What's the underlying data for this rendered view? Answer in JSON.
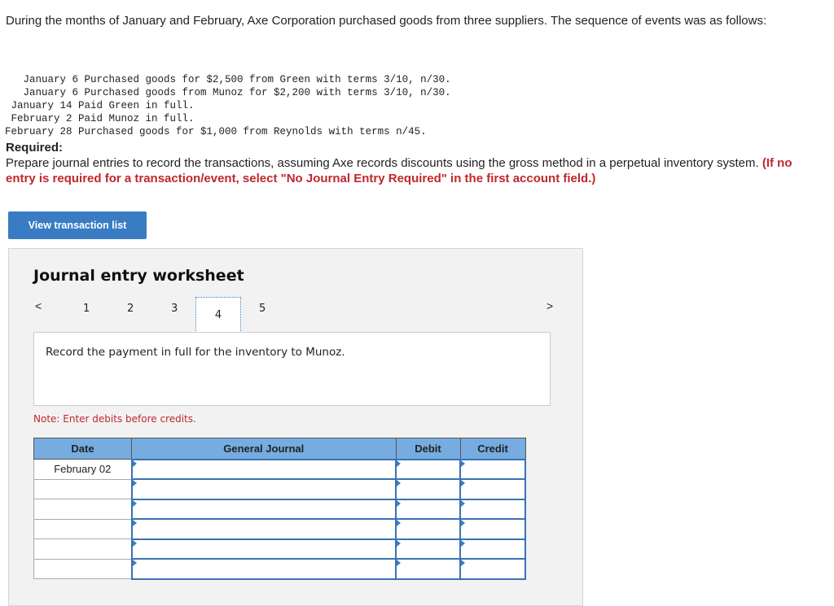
{
  "intro": "During the months of January and February, Axe Corporation purchased goods from three suppliers. The sequence of events was as follows:",
  "events": [
    "   January 6 Purchased goods for $2,500 from Green with terms 3/10, n/30.",
    "   January 6 Purchased goods from Munoz for $2,200 with terms 3/10, n/30.",
    " January 14 Paid Green in full.",
    " February 2 Paid Munoz in full.",
    "February 28 Purchased goods for $1,000 from Reynolds with terms n/45."
  ],
  "required": {
    "heading": "Required:",
    "text": "Prepare journal entries to record the transactions, assuming Axe records discounts using the gross method in a perpetual inventory system.",
    "note": "(If no entry is required for a transaction/event, select \"No Journal Entry Required\" in the first account field.)"
  },
  "view_button": "View transaction list",
  "worksheet": {
    "title": "Journal entry worksheet",
    "pages": [
      "1",
      "2",
      "3",
      "4",
      "5"
    ],
    "selected_page": "4",
    "prev": "<",
    "next": ">",
    "description": "Record the payment in full for the inventory to Munoz.",
    "note": "Note: Enter debits before credits.",
    "headers": [
      "Date",
      "General Journal",
      "Debit",
      "Credit"
    ],
    "rows": [
      {
        "date": "February 02"
      },
      {
        "date": ""
      },
      {
        "date": ""
      },
      {
        "date": ""
      },
      {
        "date": ""
      },
      {
        "date": ""
      }
    ]
  }
}
